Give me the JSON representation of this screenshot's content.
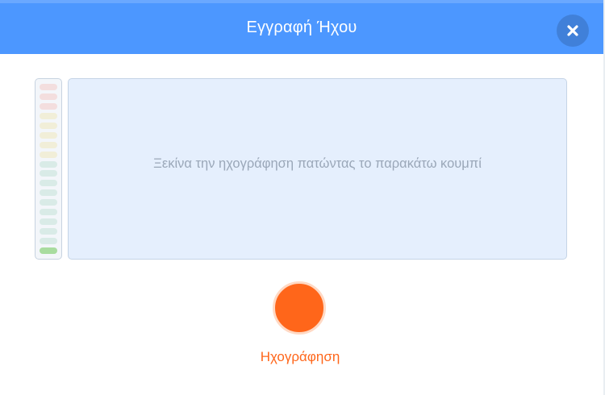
{
  "modal": {
    "title": "Εγγραφή Ήχου",
    "close_icon": "close-icon"
  },
  "colors": {
    "header": "#4c97ff",
    "record": "#ff661a",
    "waveform_bg": "#e5effd",
    "meter_red": "#f3dede",
    "meter_yellow": "#f1eed8",
    "meter_green": "#d9ebe7",
    "meter_active": "#a8dc9f"
  },
  "level_meter": {
    "bars": [
      "red",
      "red",
      "red",
      "yellow",
      "yellow",
      "yellow",
      "yellow",
      "yellow",
      "green",
      "green",
      "green",
      "green",
      "green",
      "green",
      "green",
      "green",
      "green",
      "active"
    ],
    "level": 0.06
  },
  "waveform": {
    "hint": "Ξεκίνα την ηχογράφηση πατώντας το παρακάτω κουμπί"
  },
  "record": {
    "label": "Ηχογράφηση"
  }
}
